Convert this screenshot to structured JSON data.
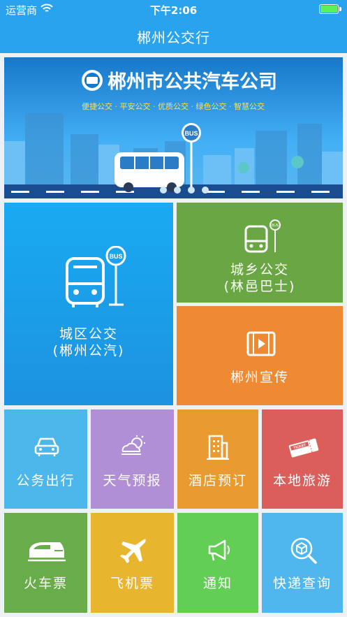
{
  "status_bar": {
    "carrier": "运营商",
    "time": "下午2:06"
  },
  "nav": {
    "title": "郴州公交行"
  },
  "banner": {
    "company": "郴州市公共汽车公司",
    "slogan": "便捷公交 · 平安公交 · 优质公交 · 绿色公交 · 智慧公交",
    "bus_sign": "BUS"
  },
  "tiles": {
    "city_bus": {
      "line1": "城区公交",
      "line2": "(郴州公汽)",
      "sign": "BUS",
      "color": "#1aa6ef"
    },
    "rural_bus": {
      "line1": "城乡公交",
      "line2": "(林邑巴士)",
      "sign": "BUS",
      "color": "#6aa744"
    },
    "promo": {
      "label": "郴州宣传",
      "color": "#ee8a33"
    },
    "official": {
      "label": "公务出行",
      "color": "#4cb7ea"
    },
    "weather": {
      "label": "天气预报",
      "color": "#b08fd7"
    },
    "hotel": {
      "label": "酒店预订",
      "color": "#e99a30"
    },
    "tourism": {
      "label": "本地旅游",
      "color": "#dc5e5a",
      "ticket": "TICKET"
    },
    "train": {
      "label": "火车票",
      "color": "#68ad49"
    },
    "flight": {
      "label": "飞机票",
      "color": "#e8b52e"
    },
    "notice": {
      "label": "通知",
      "color": "#62cf54"
    },
    "express": {
      "label": "快递查询",
      "color": "#4fb7ee"
    }
  }
}
